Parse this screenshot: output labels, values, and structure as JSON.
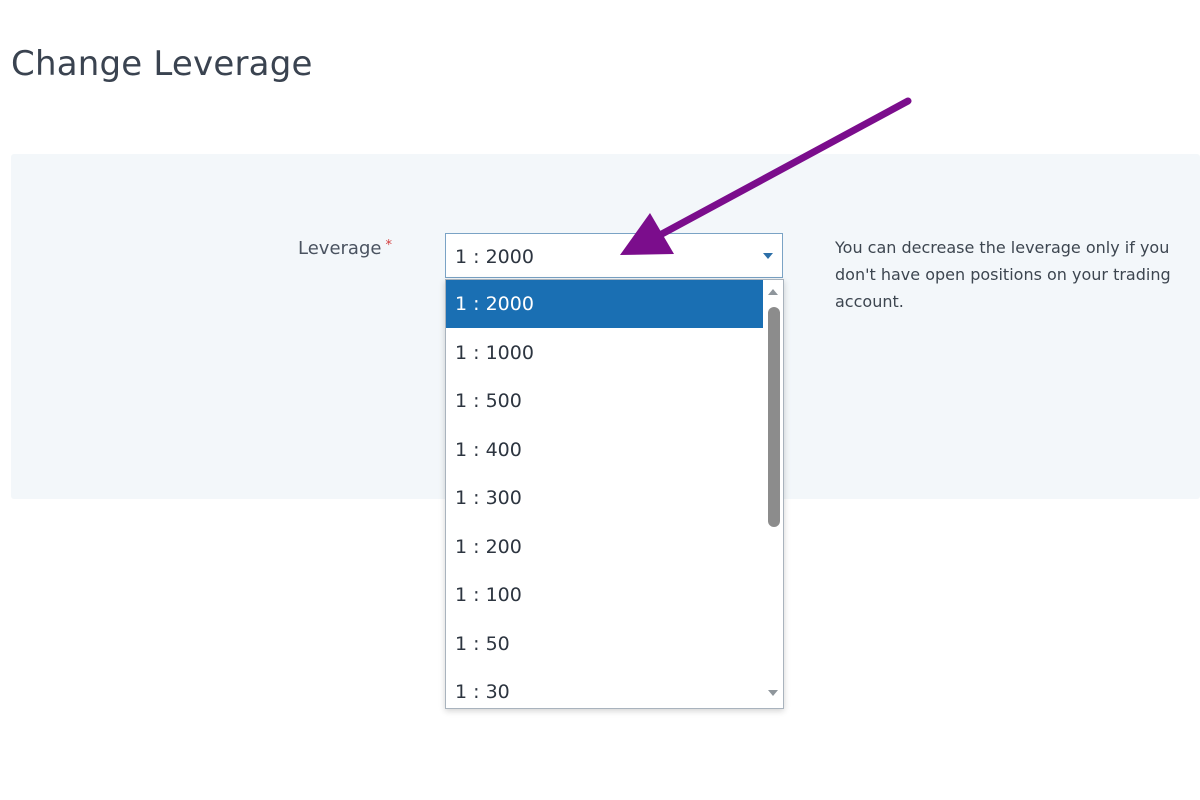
{
  "page": {
    "title": "Change Leverage"
  },
  "form": {
    "leverage_label": "Leverage",
    "required_marker": "*",
    "selected_value": "1 : 2000",
    "help_text": "You can decrease the leverage only if you don't have open positions on your trading account."
  },
  "dropdown": {
    "options": [
      "1 : 2000",
      "1 : 1000",
      "1 : 500",
      "1 : 400",
      "1 : 300",
      "1 : 200",
      "1 : 100",
      "1 : 50",
      "1 : 30"
    ],
    "highlighted_index": 0
  },
  "annotation": {
    "arrow_color": "#7b0d8c"
  },
  "colors": {
    "highlight": "#1a6fb3",
    "panel_background": "#f3f7fa",
    "required": "#d23b3b"
  }
}
